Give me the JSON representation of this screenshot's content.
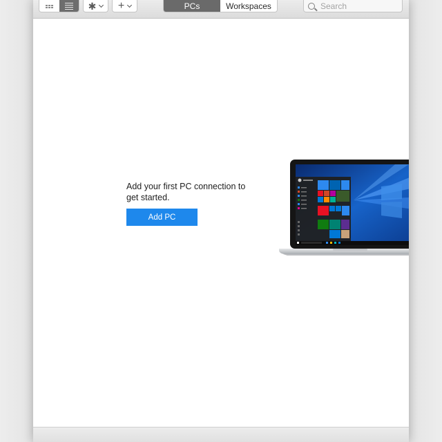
{
  "toolbar": {
    "view_modes": [
      "grid-icon",
      "list-icon"
    ],
    "active_view": "list",
    "settings_icon": "gear-icon",
    "add_icon": "plus-icon",
    "tabs": [
      {
        "label": "PCs",
        "active": true
      },
      {
        "label": "Workspaces",
        "active": false
      }
    ],
    "search": {
      "placeholder": "Search",
      "value": ""
    }
  },
  "main": {
    "empty_message": "Add your first PC connection to get started.",
    "add_pc_label": "Add PC",
    "illustration": "laptop-windows-illustration"
  },
  "colors": {
    "accent": "#1e88ec",
    "active_tab": "#6a6a6a",
    "toolbar": "#e2e2e2"
  }
}
